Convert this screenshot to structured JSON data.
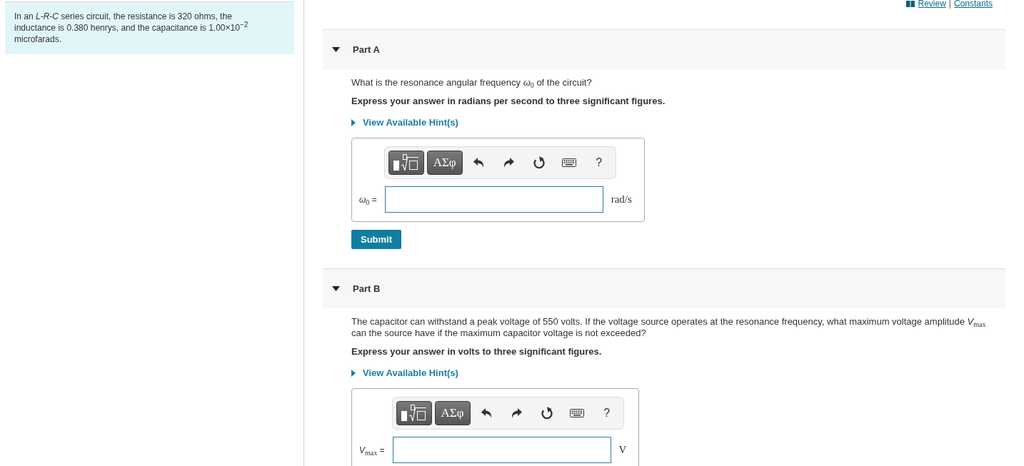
{
  "problem": {
    "text": "In an *L-R-C* series circuit, the resistance is 320 ohms, the inductance is 0.380 henrys, and the capacitance is 1.00×10$^{−2}$ microfarads."
  },
  "header_links": {
    "review": "Review",
    "separator": "|",
    "constants": "Constants"
  },
  "parts": [
    {
      "title": "Part A",
      "expanded": true,
      "question": "What is the resonance angular frequency *ω*$_{0}$ of the circuit?",
      "instruction": "Express your answer in radians per second to three significant figures.",
      "hint": {
        "label": "View Available Hint(s)",
        "expanded": false
      },
      "toolbar": {
        "symbols": "ΑΣφ",
        "help": "?"
      },
      "answer": {
        "label": "*ω*$_{0}$ =",
        "unit": "rad/s"
      },
      "submit": "Submit"
    },
    {
      "title": "Part B",
      "expanded": true,
      "question": "The capacitor can withstand a peak voltage of 550 volts. If the voltage source operates at the resonance frequency, what maximum voltage amplitude *V*$_{max}$ can the source have if the maximum capacitor voltage is not exceeded?",
      "instruction": "Express your answer in volts to three significant figures.",
      "hint": {
        "label": "View Available Hint(s)",
        "expanded": false
      },
      "toolbar": {
        "symbols": "ΑΣφ",
        "help": "?"
      },
      "answer": {
        "label": "*V*$_{max}$ =",
        "unit": "V"
      }
    }
  ]
}
